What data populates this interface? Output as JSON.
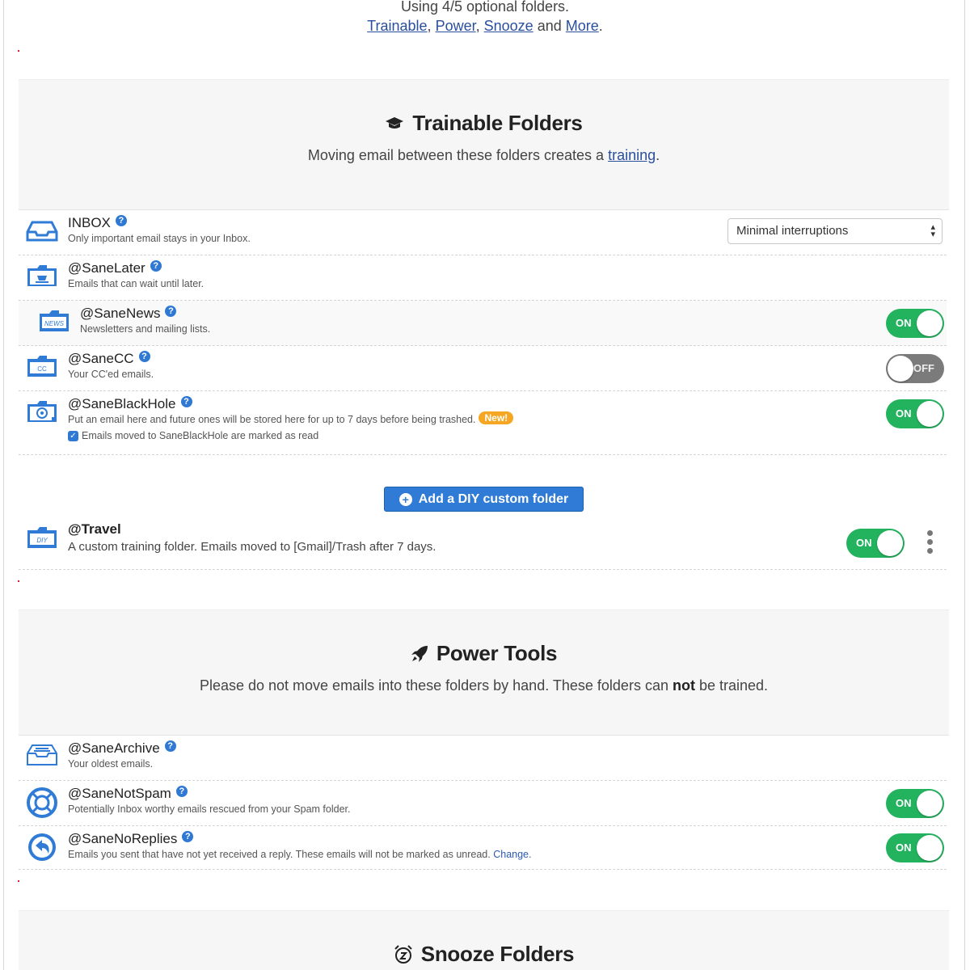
{
  "top": {
    "usage_text": "Using 4/5 optional folders.",
    "links": [
      "Trainable",
      "Power",
      "Snooze",
      "More"
    ],
    "sep1": ",",
    "sep2": ",",
    "and": "and",
    "end": "."
  },
  "trainable": {
    "title": "Trainable Folders",
    "subtitle_pre": "Moving email between these folders creates a",
    "subtitle_link": "training",
    "subtitle_post": ".",
    "folders": [
      {
        "name": "INBOX",
        "desc": "Only important email stays in your Inbox.",
        "control": "select",
        "select_value": "Minimal interruptions"
      },
      {
        "name": "@SaneLater",
        "desc": "Emails that can wait until later."
      },
      {
        "name": "@SaneNews",
        "desc": "Newsletters and mailing lists.",
        "toggle": "ON",
        "icon_text": "NEWS"
      },
      {
        "name": "@SaneCC",
        "desc": "Your CC'ed emails.",
        "toggle": "OFF",
        "icon_text": "CC"
      },
      {
        "name": "@SaneBlackHole",
        "desc": "Put an email here and future ones will be stored here for up to 7 days before being trashed.",
        "badge": "New!",
        "checkbox_label": "Emails moved to SaneBlackHole are marked as read",
        "toggle": "ON"
      }
    ],
    "diy_button": "Add a DIY custom folder",
    "custom": {
      "name": "@Travel",
      "desc": "A custom training folder. Emails moved to [Gmail]/Trash after 7 days.",
      "toggle": "ON",
      "icon_text": "DIY"
    }
  },
  "power": {
    "title": "Power Tools",
    "subtitle_pre": "Please do not move emails into these folders by hand. These folders can",
    "subtitle_bold": "not",
    "subtitle_post": "be trained.",
    "folders": [
      {
        "name": "@SaneArchive",
        "desc": "Your oldest emails."
      },
      {
        "name": "@SaneNotSpam",
        "desc": "Potentially Inbox worthy emails rescued from your Spam folder.",
        "toggle": "ON"
      },
      {
        "name": "@SaneNoReplies",
        "desc": "Emails you sent that have not yet received a reply. These emails will not be marked as unread.",
        "link": "Change.",
        "toggle": "ON"
      }
    ]
  },
  "snooze": {
    "title": "Snooze Folders"
  },
  "colors": {
    "accent": "#2f7bd5",
    "toggle_on": "#23b35f",
    "toggle_off": "#7b7b7b",
    "badge": "#f5a623",
    "link": "#2a4f9c"
  },
  "icons": {
    "help": "?",
    "trainable": "graduation-cap-icon",
    "power": "rocket-icon",
    "snooze": "alarm-clock-icon",
    "kebab": "vertical-dots-icon"
  }
}
